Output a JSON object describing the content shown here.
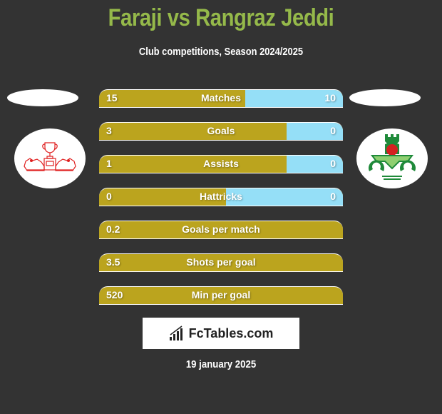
{
  "header": {
    "title": "Faraji vs Rangraz Jeddi",
    "subtitle": "Club competitions, Season 2024/2025"
  },
  "players": {
    "left": {
      "name": "Faraji",
      "logo_icon": "trophy-lions-crest-icon"
    },
    "right": {
      "name": "Rangraz Jeddi",
      "logo_icon": "zob-ahan-crest-icon"
    }
  },
  "colors": {
    "left_bar": "#bba41e",
    "right_bar": "#95dff7",
    "title": "#95b94a",
    "background": "#333333"
  },
  "stats": [
    {
      "label": "Matches",
      "left": "15",
      "right": "10",
      "left_share": 0.6
    },
    {
      "label": "Goals",
      "left": "3",
      "right": "0",
      "left_share": 0.77
    },
    {
      "label": "Assists",
      "left": "1",
      "right": "0",
      "left_share": 0.77
    },
    {
      "label": "Hattricks",
      "left": "0",
      "right": "0",
      "left_share": 0.52
    },
    {
      "label": "Goals per match",
      "left": "0.2",
      "right": "",
      "left_share": 1.0
    },
    {
      "label": "Shots per goal",
      "left": "3.5",
      "right": "",
      "left_share": 1.0
    },
    {
      "label": "Min per goal",
      "left": "520",
      "right": "",
      "left_share": 1.0
    }
  ],
  "brand": {
    "name": "FcTables.com",
    "icon": "bar-chart-icon"
  },
  "footer": {
    "date": "19 january 2025"
  }
}
